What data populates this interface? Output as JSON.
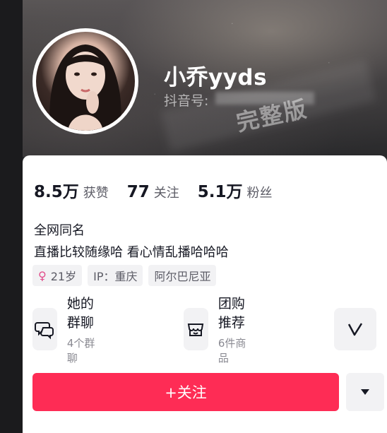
{
  "profile": {
    "username": "小乔yyds",
    "douyin_id_label": "抖音号:",
    "watermark": "完整版"
  },
  "stats": {
    "likes_value": "8.5万",
    "likes_label": "获赞",
    "following_value": "77",
    "following_label": "关注",
    "followers_value": "5.1万",
    "followers_label": "粉丝"
  },
  "bio": {
    "line1": "全网同名",
    "line2": "直播比较随缘哈 看心情乱播哈哈哈"
  },
  "tags": {
    "age": "21岁",
    "ip": "IP：重庆",
    "location": "阿尔巴尼亚"
  },
  "cards": {
    "group_chat_title": "她的群聊",
    "group_chat_sub": "4个群聊",
    "group_buy_title": "团购推荐",
    "group_buy_sub": "6件商品"
  },
  "actions": {
    "follow_label": "+关注"
  },
  "colors": {
    "accent": "#fe2c55",
    "gender_female": "#e14c8a"
  }
}
